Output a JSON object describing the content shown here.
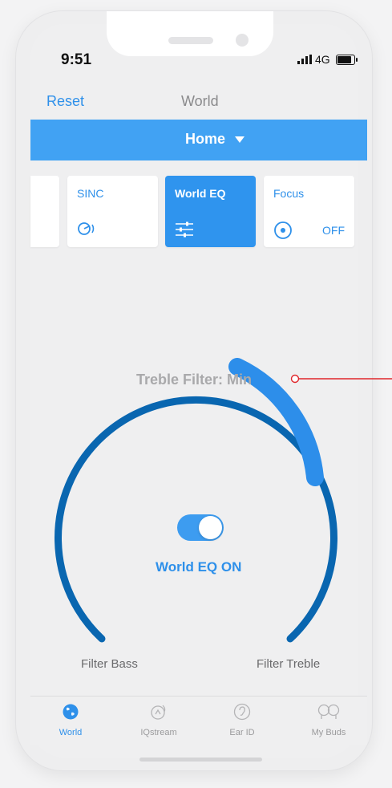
{
  "status_bar": {
    "time": "9:51",
    "network": "4G"
  },
  "nav": {
    "left_button": "Reset",
    "title": "World"
  },
  "mode_selector": {
    "label": "Home"
  },
  "presets": [
    {
      "name": "",
      "state": "",
      "icon": "blank"
    },
    {
      "name": "SINC",
      "state": "",
      "icon": "sinc-icon"
    },
    {
      "name": "World EQ",
      "state": "",
      "icon": "eq-sliders-icon",
      "active": true
    },
    {
      "name": "Focus",
      "state": "OFF",
      "icon": "focus-disc-icon"
    }
  ],
  "eq": {
    "filter_label": "Treble Filter: Min",
    "toggle_label": "World EQ ON",
    "toggle_on": true,
    "left_label": "Filter Bass",
    "right_label": "Filter Treble"
  },
  "tabs": [
    {
      "label": "World",
      "icon": "globe-icon",
      "active": true
    },
    {
      "label": "IQstream",
      "icon": "iqstream-icon"
    },
    {
      "label": "Ear ID",
      "icon": "ear-icon"
    },
    {
      "label": "My Buds",
      "icon": "earbuds-icon"
    }
  ],
  "colors": {
    "accent": "#2e90ea",
    "bar": "#41a2f3",
    "arc": "#0966b0",
    "arc_highlight": "#2d8eea",
    "pointer": "#e0262b"
  }
}
